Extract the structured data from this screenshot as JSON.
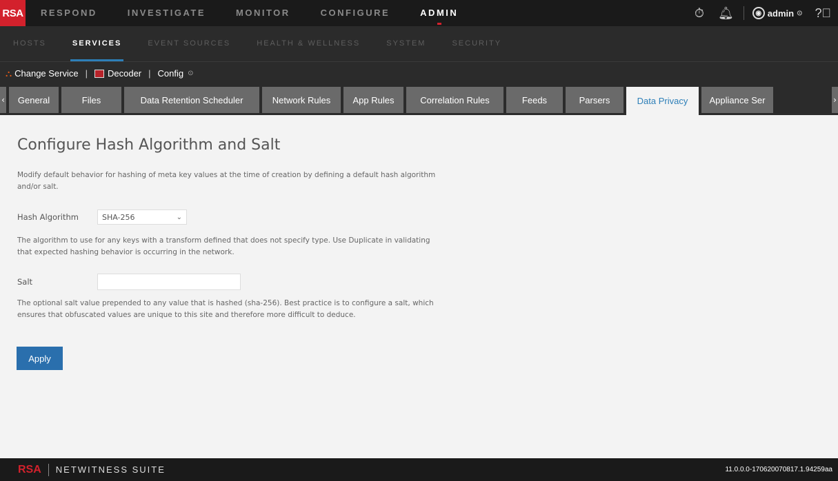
{
  "topnav": {
    "logo": "RSA",
    "items": [
      "RESPOND",
      "INVESTIGATE",
      "MONITOR",
      "CONFIGURE",
      "ADMIN"
    ],
    "user": "admin"
  },
  "subnav": {
    "items": [
      "HOSTS",
      "SERVICES",
      "EVENT SOURCES",
      "HEALTH & WELLNESS",
      "SYSTEM",
      "SECURITY"
    ]
  },
  "servicebar": {
    "change_service": "Change Service",
    "decoder": "Decoder",
    "config": "Config"
  },
  "tabs": [
    "General",
    "Files",
    "Data Retention Scheduler",
    "Network Rules",
    "App Rules",
    "Correlation Rules",
    "Feeds",
    "Parsers",
    "Data Privacy",
    "Appliance Ser"
  ],
  "content": {
    "title": "Configure Hash Algorithm and Salt",
    "intro": "Modify default behavior for hashing of meta key values at the time of creation by defining a default hash algorithm and/or salt.",
    "hash_label": "Hash Algorithm",
    "hash_value": "SHA-256",
    "hash_desc": "The algorithm to use for any keys with a transform defined that does not specify type. Use Duplicate in validating that expected hashing behavior is occurring in the network.",
    "salt_label": "Salt",
    "salt_value": "",
    "salt_desc": "The optional salt value prepended to any value that is hashed (sha-256). Best practice is to configure a salt, which ensures that obfuscated values are unique to this site and therefore more difficult to deduce.",
    "apply_label": "Apply"
  },
  "footer": {
    "logo": "RSA",
    "product": "NETWITNESS SUITE",
    "version": "11.0.0.0-170620070817.1.94259aa"
  },
  "colors": {
    "brand_red": "#d3212c",
    "accent_blue": "#2d7fb8",
    "button_blue": "#2a6fad"
  }
}
